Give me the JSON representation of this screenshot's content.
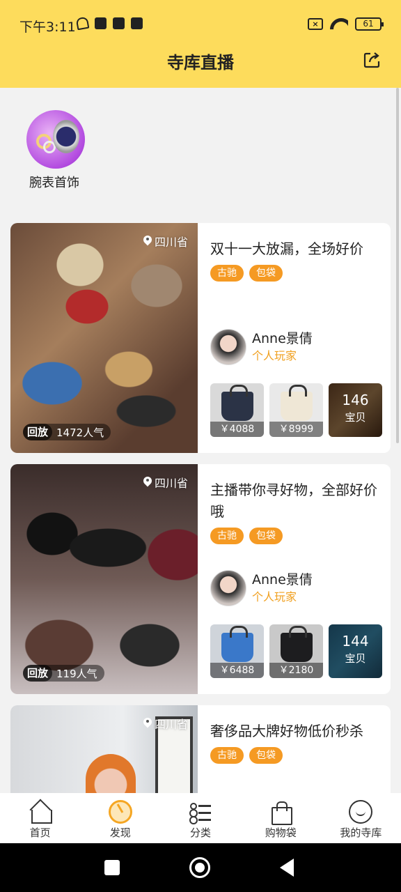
{
  "status_bar": {
    "time": "下午3:11",
    "battery": "61"
  },
  "header": {
    "title": "寺库直播"
  },
  "categories": [
    {
      "label": "腕表首饰"
    }
  ],
  "cards": [
    {
      "location": "四川省",
      "replay_tag": "回放",
      "popularity": "1472人气",
      "title": "双十一大放漏，全场好价",
      "tags": [
        "古驰",
        "包袋"
      ],
      "anchor_name": "Anne景倩",
      "anchor_role": "个人玩家",
      "goods": [
        {
          "price": "￥4088"
        },
        {
          "price": "￥8999"
        }
      ],
      "more_count": "146",
      "more_unit": "宝贝"
    },
    {
      "location": "四川省",
      "replay_tag": "回放",
      "popularity": "119人气",
      "title": "主播带你寻好物，全部好价哦",
      "tags": [
        "古驰",
        "包袋"
      ],
      "anchor_name": "Anne景倩",
      "anchor_role": "个人玩家",
      "goods": [
        {
          "price": "￥6488"
        },
        {
          "price": "￥2180"
        }
      ],
      "more_count": "144",
      "more_unit": "宝贝"
    },
    {
      "location": "四川省",
      "title": "奢侈品大牌好物低价秒杀",
      "tags": [
        "古驰",
        "包袋"
      ]
    }
  ],
  "bottom_nav": [
    {
      "label": "首页",
      "icon": "home-icon"
    },
    {
      "label": "发现",
      "icon": "discover-icon"
    },
    {
      "label": "分类",
      "icon": "category-icon"
    },
    {
      "label": "购物袋",
      "icon": "shopping-bag-icon"
    },
    {
      "label": "我的寺库",
      "icon": "smile-icon"
    }
  ],
  "colors": {
    "header_bg": "#fddc5c",
    "tag_bg": "#f59a23",
    "role_text": "#f0a020"
  }
}
